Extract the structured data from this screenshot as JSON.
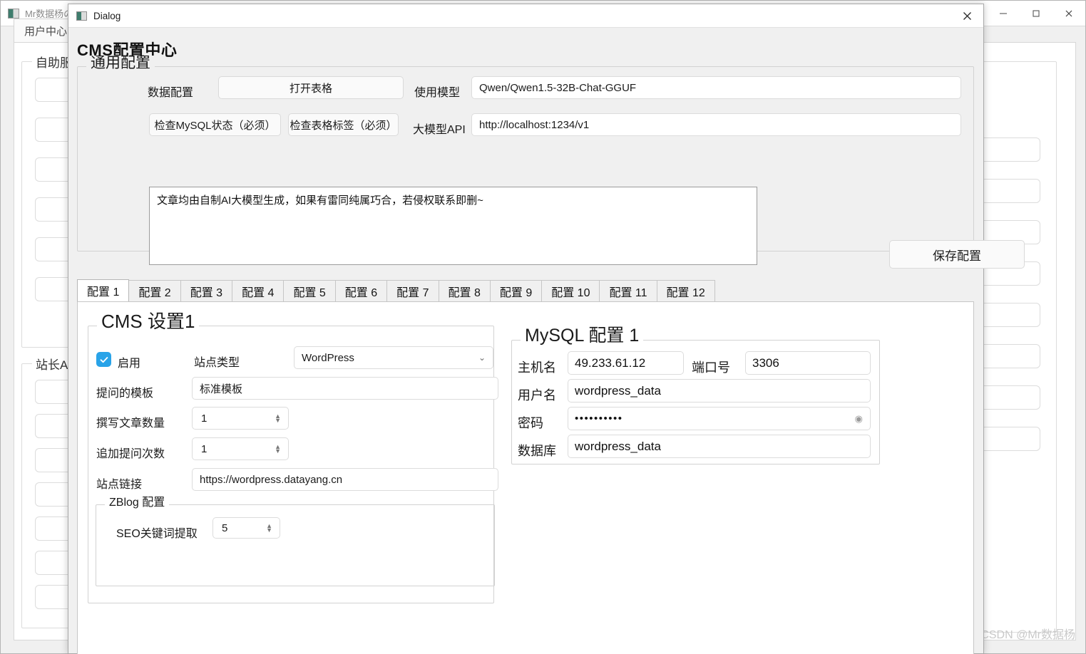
{
  "background_window": {
    "title": "Mr数据杨の",
    "icon": "app-icon",
    "tabs": [
      {
        "label": "用户中心"
      }
    ],
    "groups": [
      {
        "label": "自助服务"
      },
      {
        "label": "站长API"
      }
    ],
    "window_controls": {
      "minimize": "minimize-icon",
      "maximize": "maximize-icon",
      "close": "close-icon"
    },
    "watermark": "CSDN @Mr数据杨"
  },
  "dialog": {
    "titlebar": {
      "title": "Dialog",
      "close_label": "✕"
    },
    "app_title": "CMS配置中心",
    "general": {
      "group_title": "通用配置",
      "data_config_label": "数据配置",
      "open_table_button": "打开表格",
      "use_model_label": "使用模型",
      "model_value": "Qwen/Qwen1.5-32B-Chat-GGUF",
      "check_mysql_button": "检查MySQL状态（必须）",
      "check_table_button": "检查表格标签（必须）",
      "llm_api_label": "大模型API",
      "llm_api_value": "http://localhost:1234/v1",
      "notes_text": "文章均由自制AI大模型生成，如果有雷同纯属巧合，若侵权联系即删~",
      "save_button": "保存配置"
    },
    "tabs": [
      {
        "label": "配置 1",
        "active": true
      },
      {
        "label": "配置 2",
        "active": false
      },
      {
        "label": "配置 3",
        "active": false
      },
      {
        "label": "配置 4",
        "active": false
      },
      {
        "label": "配置 5",
        "active": false
      },
      {
        "label": "配置 6",
        "active": false
      },
      {
        "label": "配置 7",
        "active": false
      },
      {
        "label": "配置 8",
        "active": false
      },
      {
        "label": "配置 9",
        "active": false
      },
      {
        "label": "配置 10",
        "active": false
      },
      {
        "label": "配置 11",
        "active": false
      },
      {
        "label": "配置 12",
        "active": false
      }
    ],
    "cms": {
      "group_title": "CMS 设置1",
      "enable_label": "启用",
      "enable_checked": true,
      "site_type_label": "站点类型",
      "site_type_value": "WordPress",
      "prompt_template_label": "提问的模板",
      "prompt_template_value": "标准模板",
      "article_count_label": "撰写文章数量",
      "article_count_value": "1",
      "followup_label": "追加提问次数",
      "followup_value": "1",
      "site_link_label": "站点链接",
      "site_link_value": "https://wordpress.datayang.cn"
    },
    "zblog": {
      "group_title": "ZBlog 配置",
      "seo_label": "SEO关键词提取",
      "seo_value": "5"
    },
    "mysql": {
      "group_title": "MySQL 配置 1",
      "host_label": "主机名",
      "host_value": "49.233.61.12",
      "port_label": "端口号",
      "port_value": "3306",
      "user_label": "用户名",
      "user_value": "wordpress_data",
      "password_label": "密码",
      "password_value": "••••••••••",
      "database_label": "数据库",
      "database_value": "wordpress_data"
    }
  },
  "colors": {
    "accent_blue": "#29a3e8",
    "dialog_bg": "#f0f0f0",
    "panel_white": "#ffffff",
    "border_gray": "#d2d2d2",
    "watermark_gray": "#c9c9c9"
  }
}
